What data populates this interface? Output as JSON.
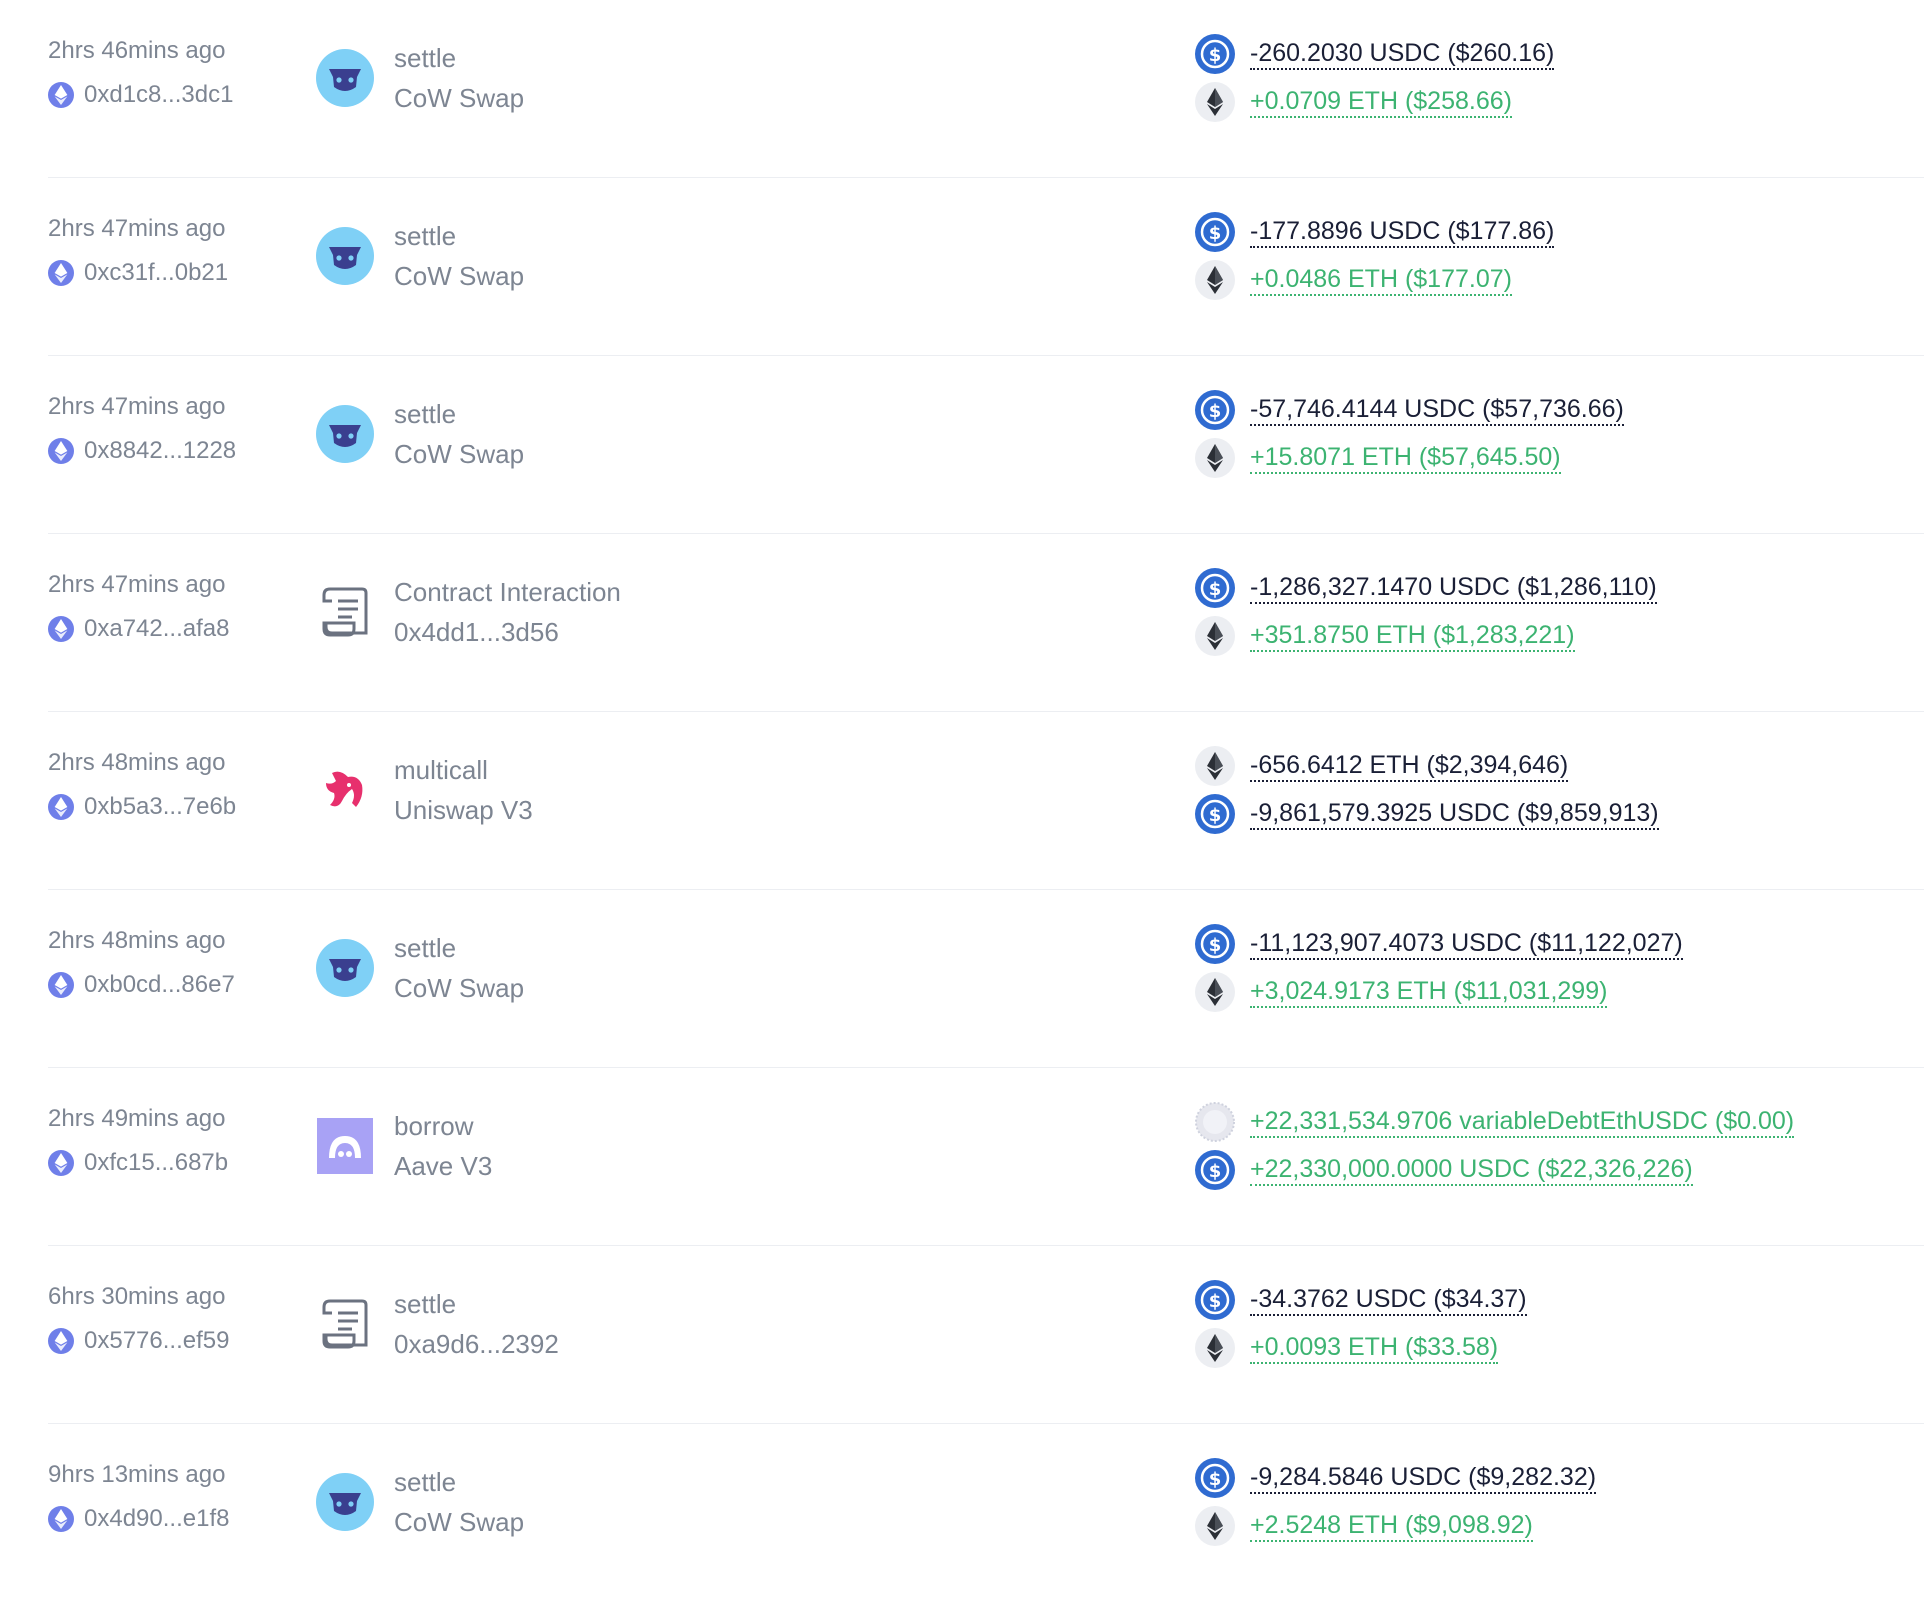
{
  "colors": {
    "text_muted": "#7d8592",
    "negative": "#1a1f36",
    "positive": "#3cb371",
    "eth_badge": "#6f7fe9",
    "usdc": "#2f6bd1",
    "cow": "#3a3f8f",
    "cow_bg": "#7fd0f6",
    "aave": "#a8a2f5",
    "uniswap": "#e7306d"
  },
  "transactions": [
    {
      "time": "2hrs 46mins ago",
      "hash": "0xd1c8...3dc1",
      "app_icon": "cow-swap-icon",
      "method": "settle",
      "app": "CoW Swap",
      "tokens": [
        {
          "icon": "usdc-icon",
          "sign": "neg",
          "text": "-260.2030 USDC ($260.16)"
        },
        {
          "icon": "eth-icon",
          "sign": "pos",
          "text": "+0.0709 ETH ($258.66)"
        }
      ]
    },
    {
      "time": "2hrs 47mins ago",
      "hash": "0xc31f...0b21",
      "app_icon": "cow-swap-icon",
      "method": "settle",
      "app": "CoW Swap",
      "tokens": [
        {
          "icon": "usdc-icon",
          "sign": "neg",
          "text": "-177.8896 USDC ($177.86)"
        },
        {
          "icon": "eth-icon",
          "sign": "pos",
          "text": "+0.0486 ETH ($177.07)"
        }
      ]
    },
    {
      "time": "2hrs 47mins ago",
      "hash": "0x8842...1228",
      "app_icon": "cow-swap-icon",
      "method": "settle",
      "app": "CoW Swap",
      "tokens": [
        {
          "icon": "usdc-icon",
          "sign": "neg",
          "text": "-57,746.4144 USDC ($57,736.66)"
        },
        {
          "icon": "eth-icon",
          "sign": "pos",
          "text": "+15.8071 ETH ($57,645.50)"
        }
      ]
    },
    {
      "time": "2hrs 47mins ago",
      "hash": "0xa742...afa8",
      "app_icon": "contract-scroll-icon",
      "method": "Contract Interaction",
      "app": "0x4dd1...3d56",
      "tokens": [
        {
          "icon": "usdc-icon",
          "sign": "neg",
          "text": "-1,286,327.1470 USDC ($1,286,110)"
        },
        {
          "icon": "eth-icon",
          "sign": "pos",
          "text": "+351.8750 ETH ($1,283,221)"
        }
      ]
    },
    {
      "time": "2hrs 48mins ago",
      "hash": "0xb5a3...7e6b",
      "app_icon": "uniswap-unicorn-icon",
      "method": "multicall",
      "app": "Uniswap V3",
      "tokens": [
        {
          "icon": "eth-icon",
          "sign": "neg",
          "text": "-656.6412 ETH ($2,394,646)"
        },
        {
          "icon": "usdc-icon",
          "sign": "neg",
          "text": "-9,861,579.3925 USDC ($9,859,913)"
        }
      ]
    },
    {
      "time": "2hrs 48mins ago",
      "hash": "0xb0cd...86e7",
      "app_icon": "cow-swap-icon",
      "method": "settle",
      "app": "CoW Swap",
      "tokens": [
        {
          "icon": "usdc-icon",
          "sign": "neg",
          "text": "-11,123,907.4073 USDC ($11,122,027)"
        },
        {
          "icon": "eth-icon",
          "sign": "pos",
          "text": "+3,024.9173 ETH ($11,031,299)"
        }
      ]
    },
    {
      "time": "2hrs 49mins ago",
      "hash": "0xfc15...687b",
      "app_icon": "aave-ghost-icon",
      "method": "borrow",
      "app": "Aave V3",
      "tokens": [
        {
          "icon": "debt-token-icon",
          "sign": "pos",
          "text": "+22,331,534.9706 variableDebtEthUSDC ($0.00)"
        },
        {
          "icon": "usdc-icon",
          "sign": "pos",
          "text": "+22,330,000.0000 USDC ($22,326,226)"
        }
      ]
    },
    {
      "time": "6hrs 30mins ago",
      "hash": "0x5776...ef59",
      "app_icon": "contract-scroll-icon",
      "method": "settle",
      "app": "0xa9d6...2392",
      "tokens": [
        {
          "icon": "usdc-icon",
          "sign": "neg",
          "text": "-34.3762 USDC ($34.37)"
        },
        {
          "icon": "eth-icon",
          "sign": "pos",
          "text": "+0.0093 ETH ($33.58)"
        }
      ]
    },
    {
      "time": "9hrs 13mins ago",
      "hash": "0x4d90...e1f8",
      "app_icon": "cow-swap-icon",
      "method": "settle",
      "app": "CoW Swap",
      "tokens": [
        {
          "icon": "usdc-icon",
          "sign": "neg",
          "text": "-9,284.5846 USDC ($9,282.32)"
        },
        {
          "icon": "eth-icon",
          "sign": "pos",
          "text": "+2.5248 ETH ($9,098.92)"
        }
      ]
    }
  ]
}
